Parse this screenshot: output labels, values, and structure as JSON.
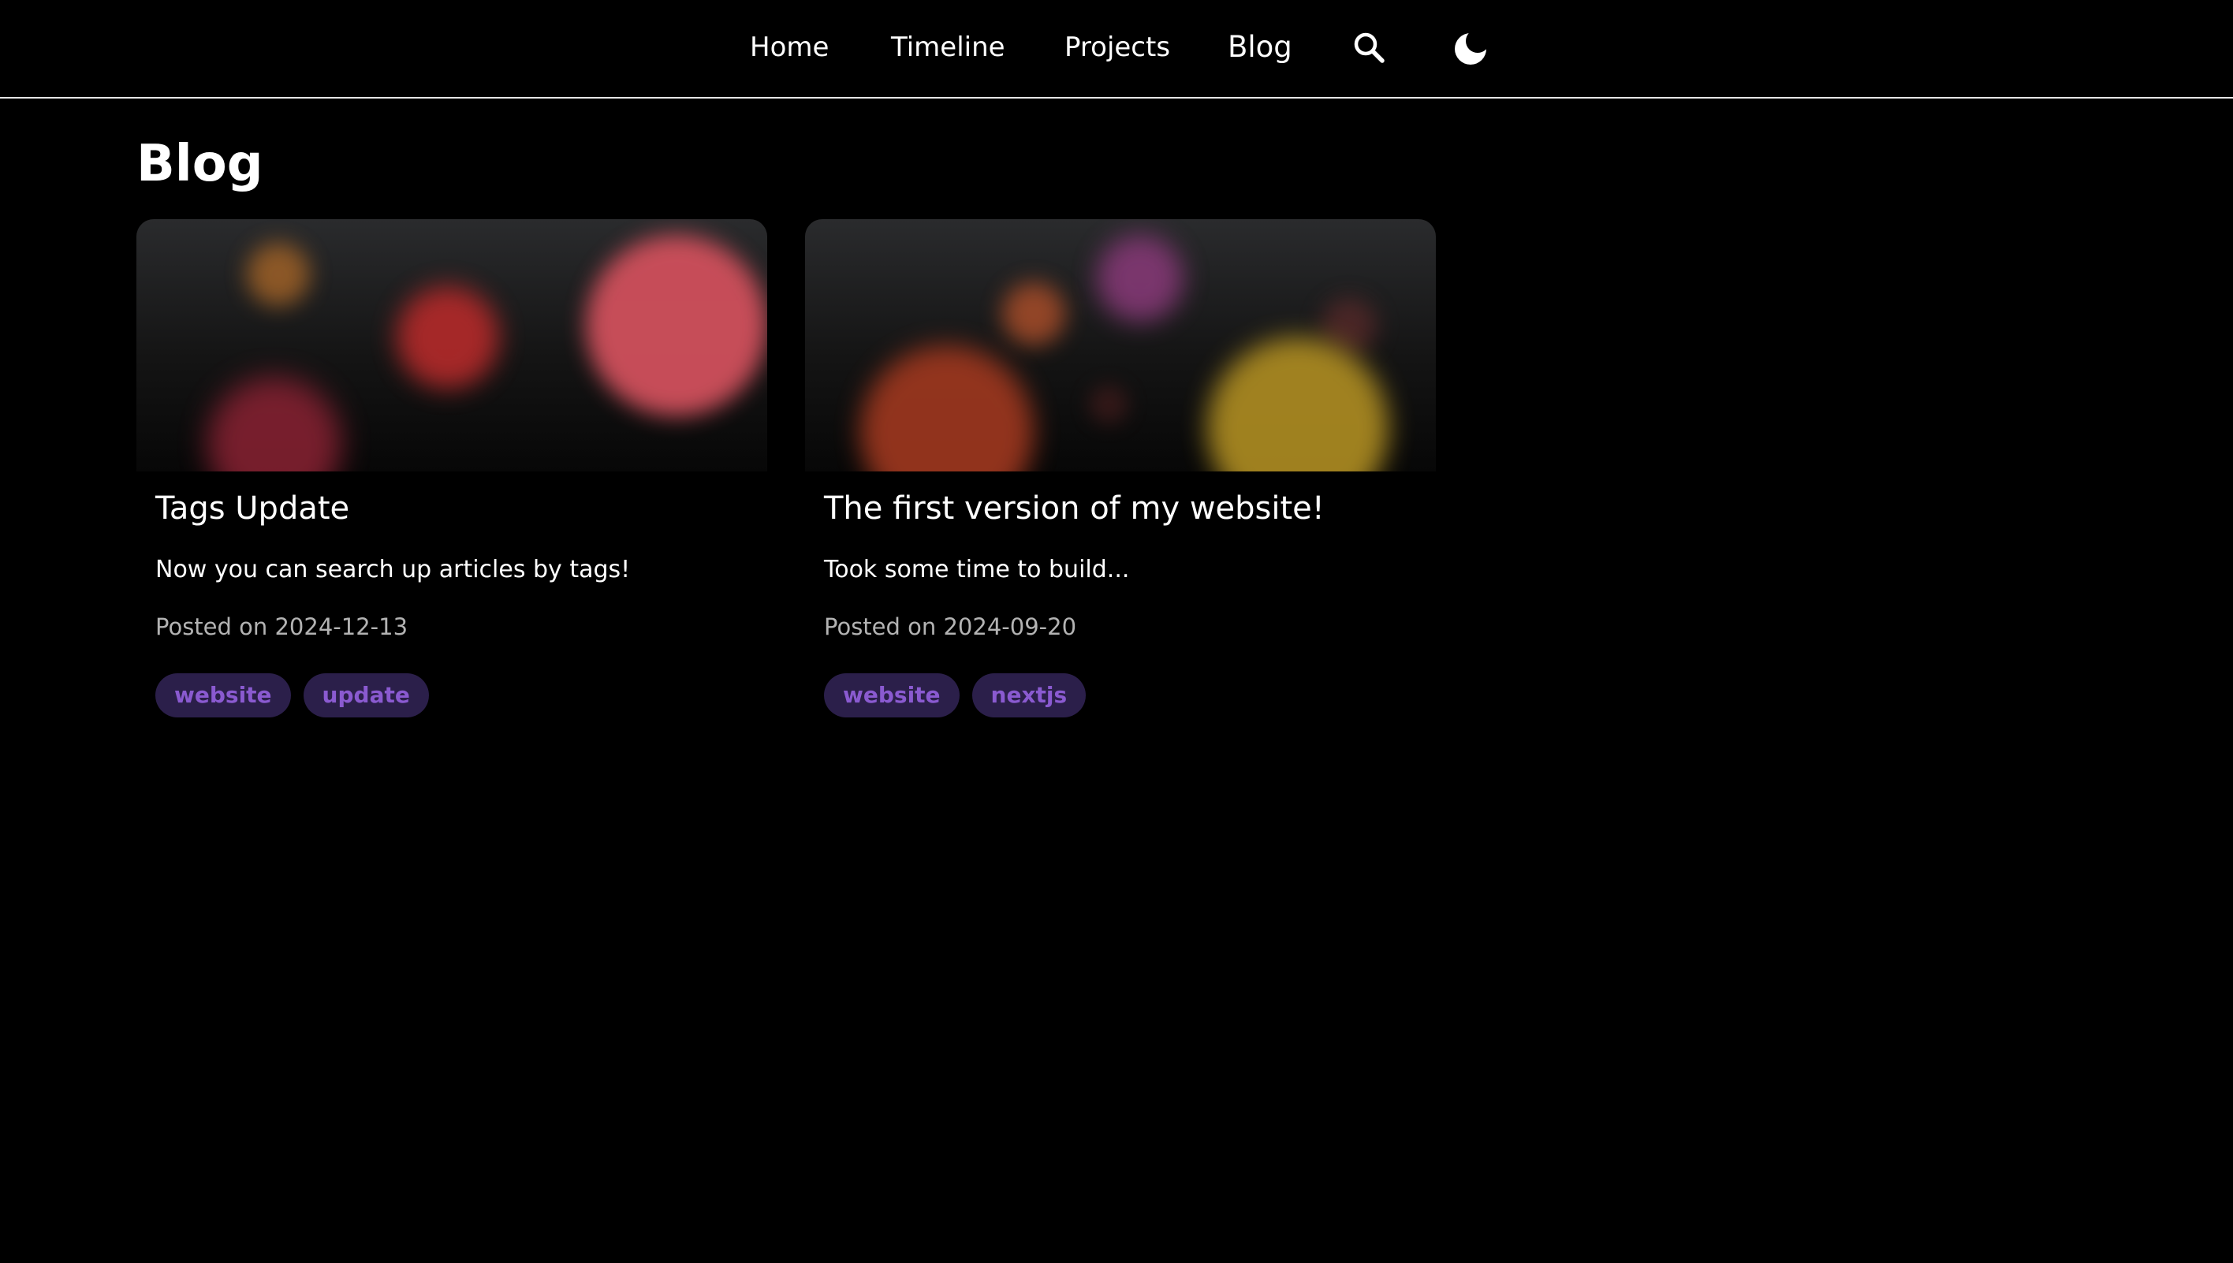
{
  "nav": {
    "items": [
      {
        "label": "Home"
      },
      {
        "label": "Timeline"
      },
      {
        "label": "Projects"
      },
      {
        "label": "Blog"
      }
    ],
    "icons": [
      "search-icon",
      "moon-icon"
    ]
  },
  "page": {
    "title": "Blog"
  },
  "posts": [
    {
      "title": "Tags Update",
      "description": "Now you can search up articles by tags!",
      "date": "Posted on 2024-12-13",
      "tags": [
        "website",
        "update"
      ]
    },
    {
      "title": "The first version of my website!",
      "description": "Took some time to build...",
      "date": "Posted on 2024-09-20",
      "tags": [
        "website",
        "nextjs"
      ]
    }
  ],
  "colors": {
    "background": "#000000",
    "text": "#ffffff",
    "muted": "#b3b3b3",
    "tag_bg": "#2b1f4a",
    "tag_text": "#8a5ad0"
  }
}
